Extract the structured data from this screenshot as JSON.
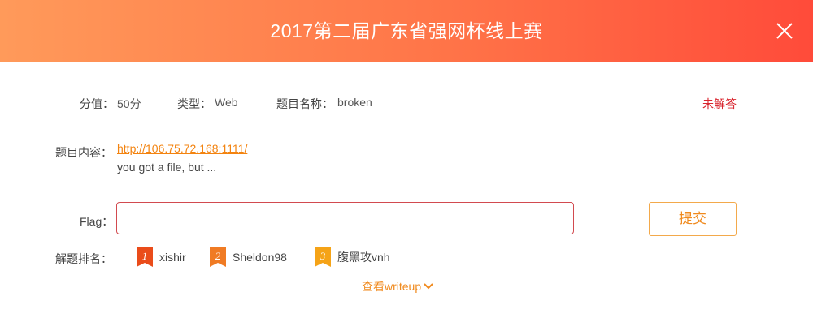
{
  "header": {
    "title": "2017第二届广东省强网杯线上赛",
    "close_icon": "close-icon"
  },
  "meta": {
    "score_label": "分值：",
    "score_value": "50分",
    "type_label": "类型：",
    "type_value": "Web",
    "name_label": "题目名称：",
    "name_value": "broken",
    "status": "未解答"
  },
  "content": {
    "label": "题目内容：",
    "link": "http://106.75.72.168:1111/",
    "description": "you got a file, but ..."
  },
  "flag": {
    "label": "Flag：",
    "value": "",
    "placeholder": ""
  },
  "submit": {
    "label": "提交"
  },
  "ranking": {
    "label": "解题排名：",
    "items": [
      {
        "rank": "1",
        "name": "xishir",
        "color": "#ea4c1a"
      },
      {
        "rank": "2",
        "name": "Sheldon98",
        "color": "#f07b24"
      },
      {
        "rank": "3",
        "name": "腹黑攻vnh",
        "color": "#f5a317"
      }
    ]
  },
  "writeup": {
    "label": "查看writeup",
    "icon": "chevron-down-icon"
  },
  "colors": {
    "header_start": "#ff9a5a",
    "header_end": "#ff4b3a",
    "status": "#d9252e",
    "accent": "#f08a1e",
    "link": "#f3830f"
  }
}
